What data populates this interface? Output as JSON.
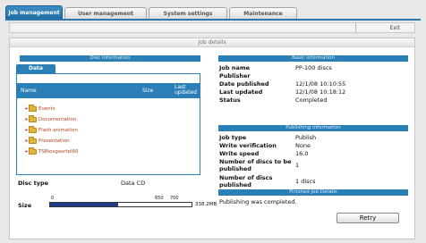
{
  "tabs": [
    {
      "label": "Job management",
      "active": true
    },
    {
      "label": "User management",
      "active": false
    },
    {
      "label": "System settings",
      "active": false
    },
    {
      "label": "Maintenance",
      "active": false
    }
  ],
  "toolbar": {
    "exit_label": "Exit"
  },
  "panel": {
    "title": "Job details"
  },
  "disc_info": {
    "section_title": "Disc information",
    "data_tab": "Data",
    "columns": [
      "Name",
      "Size",
      "Last updated"
    ],
    "folders": [
      "Events",
      "Documentation",
      "Flash animation",
      "Presentation",
      "TSBiosgasrtel60"
    ],
    "disc_type_label": "Disc type",
    "disc_type_value": "Data CD",
    "size_label": "Size",
    "size_scale_min": "0",
    "size_scale_max": "650",
    "size_scale_max2": "700",
    "size_value": "338.2MB",
    "size_fill_fraction": 0.48
  },
  "basic_info": {
    "section_title": "Basic information",
    "rows": [
      {
        "label": "Job name",
        "value": "PP-100 discs"
      },
      {
        "label": "Publisher",
        "value": ""
      },
      {
        "label": "Date published",
        "value": "12/1/08 10:10:55"
      },
      {
        "label": "Last updated",
        "value": "12/1/08 10:18:12"
      },
      {
        "label": "Status",
        "value": "Completed"
      }
    ]
  },
  "publishing_info": {
    "section_title": "Publishing information",
    "rows": [
      {
        "label": "Job type",
        "value": "Publish"
      },
      {
        "label": "Write verification",
        "value": "None"
      },
      {
        "label": "Write speed",
        "value": "16.0"
      },
      {
        "label": "Number of discs to be published",
        "value": "1"
      },
      {
        "label": "Number of discs published",
        "value": "1 discs"
      }
    ]
  },
  "completed": {
    "section_title": "Finished Job Details",
    "message": "Publishing was completed.",
    "retry_label": "Retry"
  }
}
